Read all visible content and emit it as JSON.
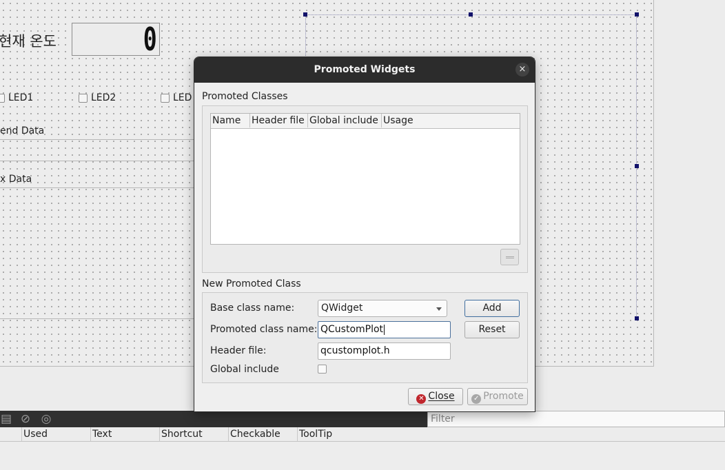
{
  "form": {
    "temperature_label": "현재 온도",
    "lcd_value": "0",
    "leds": [
      "LED1",
      "LED2",
      "LED"
    ],
    "send_group_title": "end Data",
    "rx_group_title": "x Data"
  },
  "dialog": {
    "title": "Promoted Widgets",
    "close_icon": "×",
    "promoted_classes_title": "Promoted Classes",
    "table_columns": [
      "Name",
      "Header file",
      "Global include",
      "Usage"
    ],
    "new_class_title": "New Promoted Class",
    "base_class_label": "Base class name:",
    "base_class_value": "QWidget",
    "promoted_class_label": "Promoted class name:",
    "promoted_class_value": "QCustomPlot",
    "header_file_label": "Header file:",
    "header_file_value": "qcustomplot.h",
    "global_include_label": "Global include",
    "global_include_checked": false,
    "add_label": "Add",
    "reset_label": "Reset",
    "close_label": "Close",
    "promote_label": "Promote"
  },
  "action_editor": {
    "filter_placeholder": "Filter",
    "columns": [
      "Used",
      "Text",
      "Shortcut",
      "Checkable",
      "ToolTip"
    ]
  },
  "colors": {
    "titlebar": "#2c2c2c",
    "toolbar": "#303030",
    "selection_handle": "#12126a",
    "close_icon_red": "#c0262d",
    "promote_icon_grey": "#a8a8a8"
  }
}
